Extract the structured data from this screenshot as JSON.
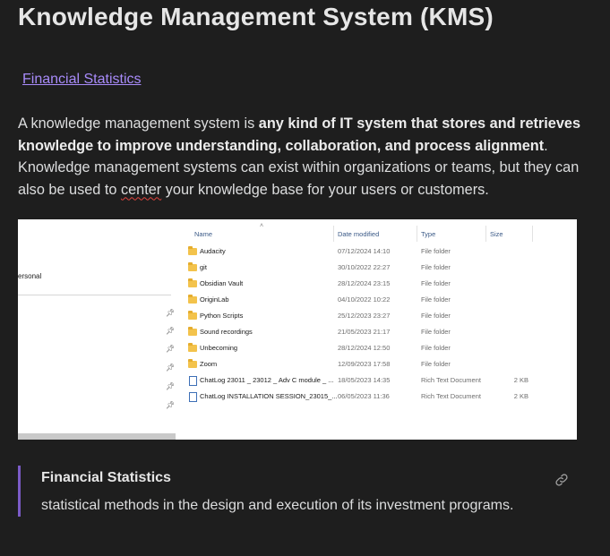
{
  "page": {
    "title": "Knowledge Management System (KMS)",
    "link_text": "Financial Statistics",
    "paragraph": {
      "intro": "A knowledge management system is ",
      "bold": "any kind of IT system that stores and retrieves knowledge to improve understanding, collaboration, and process alignment",
      "after_bold": ". Knowledge management systems can exist within organizations or teams, but they can also be used to ",
      "misspelled": "center",
      "ending": " your knowledge base for your users or customers."
    }
  },
  "screenshot": {
    "nav_item": "ersonal",
    "columns": {
      "name": "Name",
      "date": "Date modified",
      "type": "Type",
      "size": "Size"
    },
    "rows": [
      {
        "icon": "folder-icon",
        "name": "Audacity",
        "date": "07/12/2024 14:10",
        "type": "File folder",
        "size": ""
      },
      {
        "icon": "folder-icon",
        "name": "git",
        "date": "30/10/2022 22:27",
        "type": "File folder",
        "size": ""
      },
      {
        "icon": "folder-icon",
        "name": "Obsidian Vault",
        "date": "28/12/2024 23:15",
        "type": "File folder",
        "size": ""
      },
      {
        "icon": "folder-icon",
        "name": "OriginLab",
        "date": "04/10/2022 10:22",
        "type": "File folder",
        "size": ""
      },
      {
        "icon": "folder-icon",
        "name": "Python Scripts",
        "date": "25/12/2023 23:27",
        "type": "File folder",
        "size": ""
      },
      {
        "icon": "folder-icon",
        "name": "Sound recordings",
        "date": "21/05/2023 21:17",
        "type": "File folder",
        "size": ""
      },
      {
        "icon": "folder-icon",
        "name": "Unbecoming",
        "date": "28/12/2024 12:50",
        "type": "File folder",
        "size": ""
      },
      {
        "icon": "folder-icon",
        "name": "Zoom",
        "date": "12/09/2023 17:58",
        "type": "File folder",
        "size": ""
      },
      {
        "icon": "document-icon",
        "name": "ChatLog 23011 _ 23012 _ Adv C module _ ...",
        "date": "18/05/2023 14:35",
        "type": "Rich Text Document",
        "size": "2 KB"
      },
      {
        "icon": "document-icon",
        "name": "ChatLog INSTALLATION SESSION_23015_...",
        "date": "06/05/2023 11:36",
        "type": "Rich Text Document",
        "size": "2 KB"
      }
    ],
    "colors": {
      "folder": "#f3c34c",
      "header_text": "#3b5a87"
    }
  },
  "callout": {
    "title": "Financial Statistics",
    "text": "statistical methods in the design and execution of its investment programs.",
    "link_icon": "link-icon"
  },
  "theme": {
    "background": "#1e1e1e",
    "accent": "#a88bfa",
    "callout_bar": "#7b5bc7"
  }
}
